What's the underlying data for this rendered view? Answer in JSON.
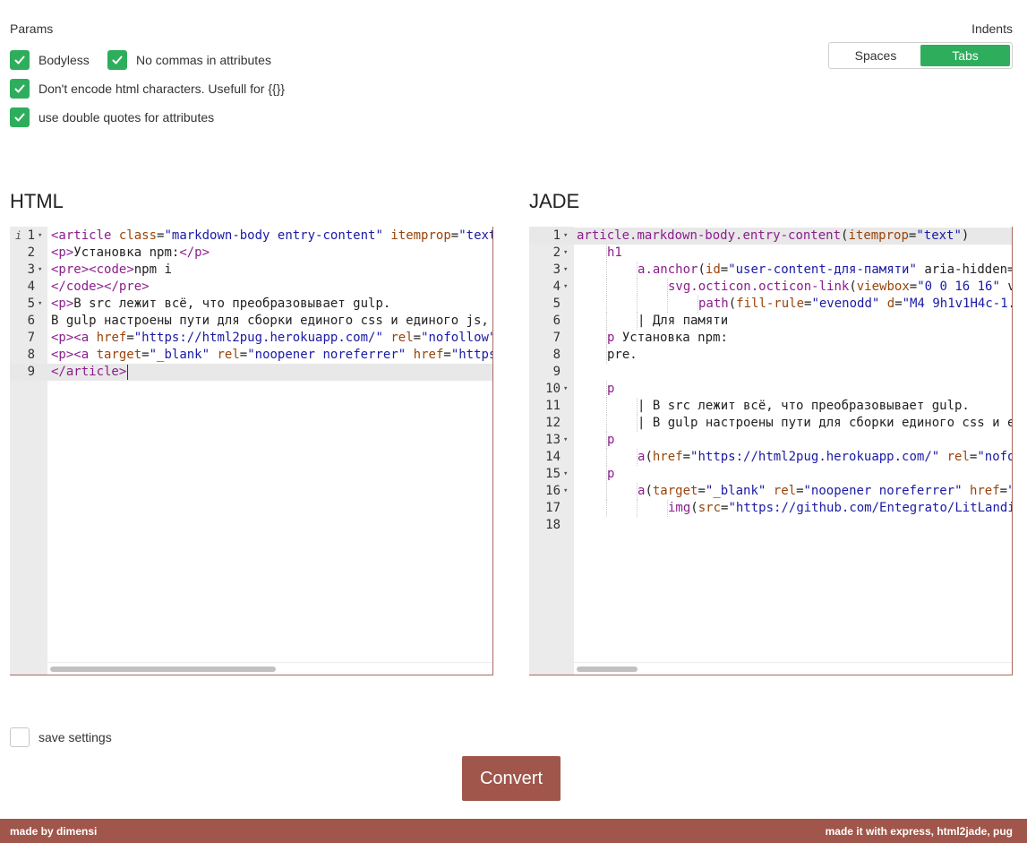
{
  "params": {
    "title": "Params",
    "options": [
      {
        "label": "Bodyless",
        "checked": true
      },
      {
        "label": "No commas in attributes",
        "checked": true
      },
      {
        "label": "Don't encode html characters. Usefull for {{}}",
        "checked": true
      },
      {
        "label": "use double quotes for attributes",
        "checked": true
      }
    ]
  },
  "indents": {
    "title": "Indents",
    "options": [
      "Spaces",
      "Tabs"
    ],
    "selected": "Tabs"
  },
  "html_panel": {
    "title": "HTML",
    "line_numbers": [
      "1",
      "2",
      "3",
      "4",
      "5",
      "6",
      "7",
      "8",
      "9"
    ],
    "info_marker": "i",
    "lines": [
      "<article class=\"markdown-body entry-content\" itemprop=\"text",
      "<p>Установка npm:</p>",
      "<pre><code>npm i",
      "</code></pre>",
      "<p>В src лежит всё, что преобразовывает gulp.",
      "В gulp настроены пути для сборки единого css и единого js,",
      "<p><a href=\"https://html2pug.herokuapp.com/\" rel=\"nofollow\"",
      "<p><a target=\"_blank\" rel=\"noopener noreferrer\" href=\"https",
      "</article>"
    ]
  },
  "jade_panel": {
    "title": "JADE",
    "line_numbers": [
      "1",
      "2",
      "3",
      "4",
      "5",
      "6",
      "7",
      "8",
      "9",
      "10",
      "11",
      "12",
      "13",
      "14",
      "15",
      "16",
      "17",
      "18"
    ],
    "lines": [
      "article.markdown-body.entry-content(itemprop=\"text\")",
      "h1",
      "a.anchor(id=\"user-content-для-памяти\" aria-hidden=",
      "svg.octicon.octicon-link(viewbox=\"0 0 16 16\" v",
      "path(fill-rule=\"evenodd\" d=\"M4 9h1v1H4c-1.",
      "| Для памяти",
      "p Установка npm:",
      "pre.",
      "",
      "p",
      "| В src лежит всё, что преобразовывает gulp.",
      "| В gulp настроены пути для сборки единого css и е",
      "p",
      "a(href=\"https://html2pug.herokuapp.com/\" rel=\"nofo",
      "p",
      "a(target=\"_blank\" rel=\"noopener noreferrer\" href=\"",
      "img(src=\"https://github.com/Entegrato/LitLandi",
      ""
    ]
  },
  "save_settings": {
    "label": "save settings",
    "checked": false
  },
  "convert_button": "Convert",
  "footer": {
    "left": "made by dimensi",
    "right": "made it with express, html2jade, pug"
  },
  "colors": {
    "accent_green": "#2eae5c",
    "brand_brown": "#a0564a"
  }
}
